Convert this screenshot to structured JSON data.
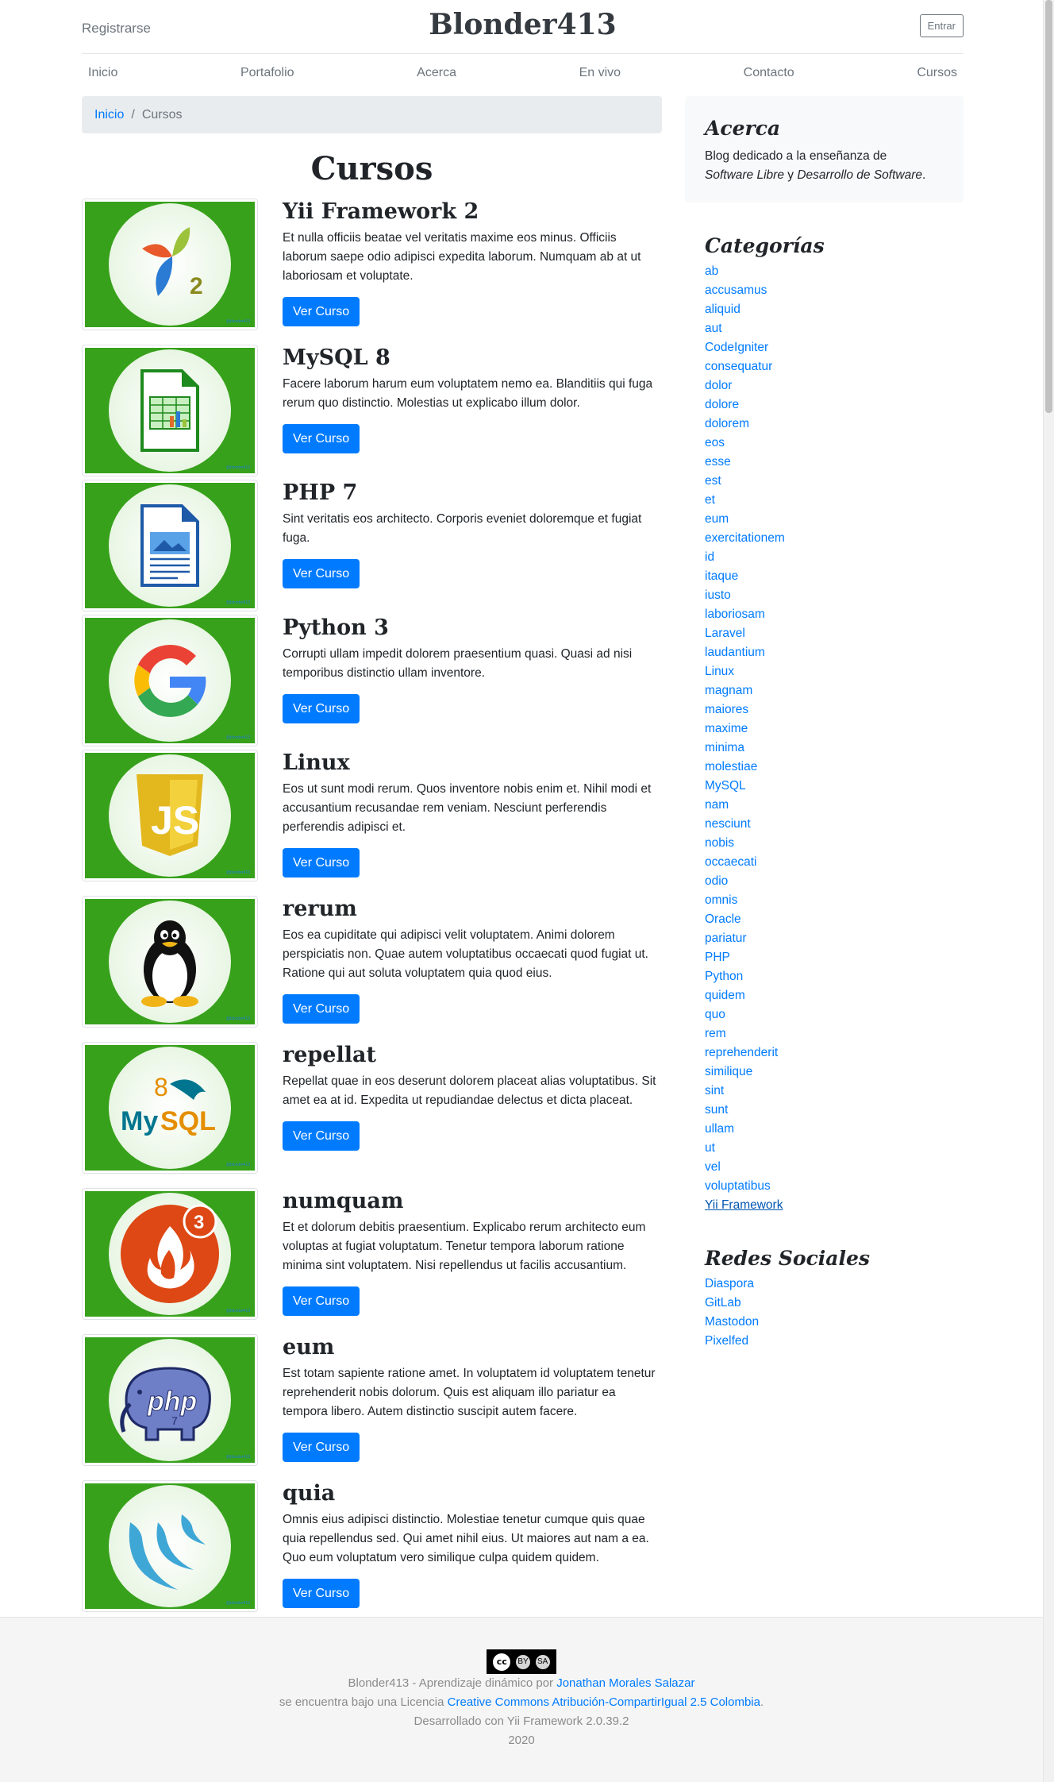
{
  "header": {
    "register": "Registrarse",
    "brand": "Blonder413",
    "login": "Entrar"
  },
  "nav": [
    "Inicio",
    "Portafolio",
    "Acerca",
    "En vivo",
    "Contacto",
    "Cursos"
  ],
  "breadcrumb": {
    "home": "Inicio",
    "separator": "/",
    "current": "Cursos"
  },
  "page_title": "Cursos",
  "button_label": "Ver Curso",
  "courses": [
    {
      "title": "Yii Framework 2",
      "text": "Et nulla officiis beatae vel veritatis maxime eos minus. Officiis laborum saepe odio adipisci expedita laborum. Numquam ab at ut laboriosam et voluptate.",
      "icon": "yii-logo-icon"
    },
    {
      "title": "MySQL 8",
      "text": "Facere laborum harum eum voluptatem nemo ea. Blanditiis qui fuga rerum quo distinctio. Molestias ut explicabo illum dolor.",
      "icon": "spreadsheet-icon"
    },
    {
      "title": "PHP 7",
      "text": "Sint veritatis eos architecto. Corporis eveniet doloremque et fugiat fuga.",
      "icon": "document-icon"
    },
    {
      "title": "Python 3",
      "text": "Corrupti ullam impedit dolorem praesentium quasi. Quasi ad nisi temporibus distinctio ullam inventore.",
      "icon": "google-logo-icon"
    },
    {
      "title": "Linux",
      "text": "Eos ut sunt modi rerum. Quos inventore nobis enim et. Nihil modi et accusantium recusandae rem veniam. Nesciunt perferendis perferendis adipisci et.",
      "icon": "javascript-logo-icon"
    },
    {
      "title": "rerum",
      "text": "Eos ea cupiditate qui adipisci velit voluptatem. Animi dolorem perspiciatis non. Quae autem voluptatibus occaecati quod fugiat ut. Ratione qui aut soluta voluptatem quia quod eius.",
      "icon": "tux-penguin-icon"
    },
    {
      "title": "repellat",
      "text": "Repellat quae in eos deserunt dolorem placeat alias voluptatibus. Sit amet ea at id. Expedita ut repudiandae delectus et dicta placeat.",
      "icon": "mysql-logo-icon"
    },
    {
      "title": "numquam",
      "text": "Et et dolorum debitis praesentium. Explicabo rerum architecto eum voluptas at fugiat voluptatum. Tenetur tempora laborum ratione minima sint voluptatem. Nisi repellendus ut facilis accusantium.",
      "icon": "codeigniter-logo-icon"
    },
    {
      "title": "eum",
      "text": "Est totam sapiente ratione amet. In voluptatem id voluptatem tenetur reprehenderit nobis dolorum. Quis est aliquam illo pariatur ea tempora libero. Autem distinctio suscipit autem facere.",
      "icon": "php-elephant-icon"
    },
    {
      "title": "quia",
      "text": "Omnis eius adipisci distinctio. Molestiae tenetur cumque quis quae quia repellendus sed. Qui amet nihil eius. Ut maiores aut nam a ea. Quo eum voluptatum vero similique culpa quidem quidem.",
      "icon": "jquery-logo-icon"
    }
  ],
  "thumb_watermark": "@blonder413",
  "images_text": {
    "yii_badge": "2",
    "mysql_version": "8",
    "mysql_word": "MySQL",
    "codeigniter_badge": "3",
    "php_word": "php",
    "php_version": "7"
  },
  "sidebar": {
    "about_title": "Acerca",
    "about_text_1": "Blog dedicado a la enseñanza de",
    "about_em_1": "Software Libre",
    "about_text_2": " y ",
    "about_em_2": "Desarrollo de Software",
    "about_text_3": ".",
    "categories_title": "Categorías",
    "categories": [
      "ab",
      "accusamus",
      "aliquid",
      "aut",
      "CodeIgniter",
      "consequatur",
      "dolor",
      "dolore",
      "dolorem",
      "eos",
      "esse",
      "est",
      "et",
      "eum",
      "exercitationem",
      "id",
      "itaque",
      "iusto",
      "laboriosam",
      "Laravel",
      "laudantium",
      "Linux",
      "magnam",
      "maiores",
      "maxime",
      "minima",
      "molestiae",
      "MySQL",
      "nam",
      "nesciunt",
      "nobis",
      "occaecati",
      "odio",
      "omnis",
      "Oracle",
      "pariatur",
      "PHP",
      "Python",
      "quidem",
      "quo",
      "rem",
      "reprehenderit",
      "similique",
      "sint",
      "sunt",
      "ullam",
      "ut",
      "vel",
      "voluptatibus",
      "Yii Framework"
    ],
    "social_title": "Redes Sociales",
    "social": [
      "Diaspora",
      "GitLab",
      "Mastodon",
      "Pixelfed"
    ]
  },
  "footer": {
    "badge_by": "BY",
    "badge_sa": "SA",
    "line1_prefix": "Blonder413 - Aprendizaje dinámico por ",
    "line1_link": "Jonathan Morales Salazar",
    "line2_prefix": "se encuentra bajo una Licencia ",
    "line2_link": "Creative Commons Atribución-CompartirIgual 2.5 Colombia",
    "line2_suffix": ".",
    "line3": "Desarrollado con Yii Framework 2.0.39.2",
    "line4": "2020"
  },
  "colors": {
    "link": "#007bff",
    "thumb_green": "#37a11b",
    "button": "#007bff",
    "breadcrumb_bg": "#e9ecef"
  }
}
